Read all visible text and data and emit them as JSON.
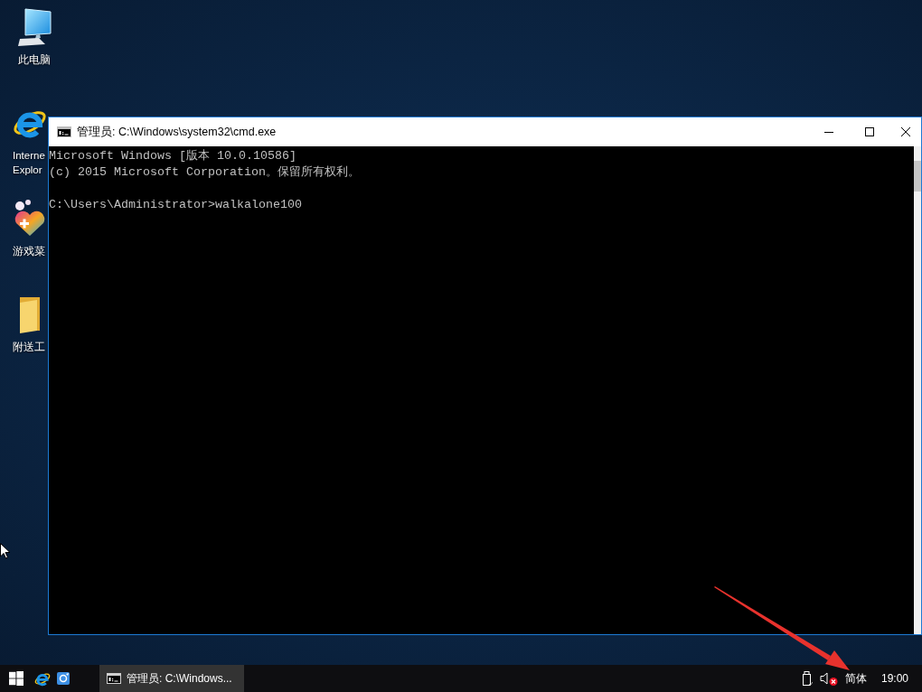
{
  "desktop_icons": [
    {
      "kind": "computer",
      "label_lines": [
        "此电脑"
      ]
    },
    {
      "kind": "browser",
      "label_lines": [
        "Interne",
        "Explor"
      ]
    },
    {
      "kind": "game",
      "label_lines": [
        "游戏菜"
      ]
    },
    {
      "kind": "folder",
      "label_lines": [
        "附送工"
      ]
    }
  ],
  "window": {
    "title": "管理员: C:\\Windows\\system32\\cmd.exe",
    "console": {
      "lines": [
        "Microsoft Windows [版本 10.0.10586]",
        "(c) 2015 Microsoft Corporation。保留所有权利。"
      ],
      "prompt": "C:\\Users\\Administrator>walkalone100"
    }
  },
  "taskbar": {
    "window_button": {
      "label": "管理员: C:\\Windows...",
      "active": true
    },
    "tray": {
      "muted": true,
      "input_language": "简体",
      "time": "19:00"
    }
  }
}
